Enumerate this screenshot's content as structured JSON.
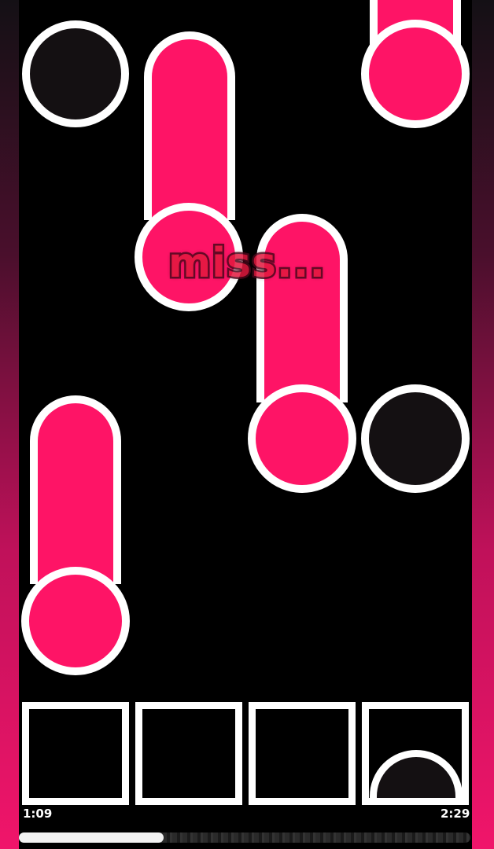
{
  "game": {
    "judgement_text": "miss...",
    "time_elapsed": "1:09",
    "time_total": "2:29",
    "progress": 0.32,
    "lanes": 4,
    "colors": {
      "note": "#fe1466",
      "outline": "#ffffff",
      "empty_note": "#141012",
      "background": "#000000"
    },
    "notes": [
      {
        "lane": 1,
        "kind": "tap",
        "fill": "dark"
      },
      {
        "lane": 2,
        "kind": "hold",
        "fill": "pink"
      },
      {
        "lane": 4,
        "kind": "hold",
        "fill": "pink"
      },
      {
        "lane": 3,
        "kind": "hold",
        "fill": "pink"
      },
      {
        "lane": 4,
        "kind": "tap",
        "fill": "dark"
      },
      {
        "lane": 1,
        "kind": "hold",
        "fill": "pink"
      }
    ],
    "pressed_lane": 4
  }
}
